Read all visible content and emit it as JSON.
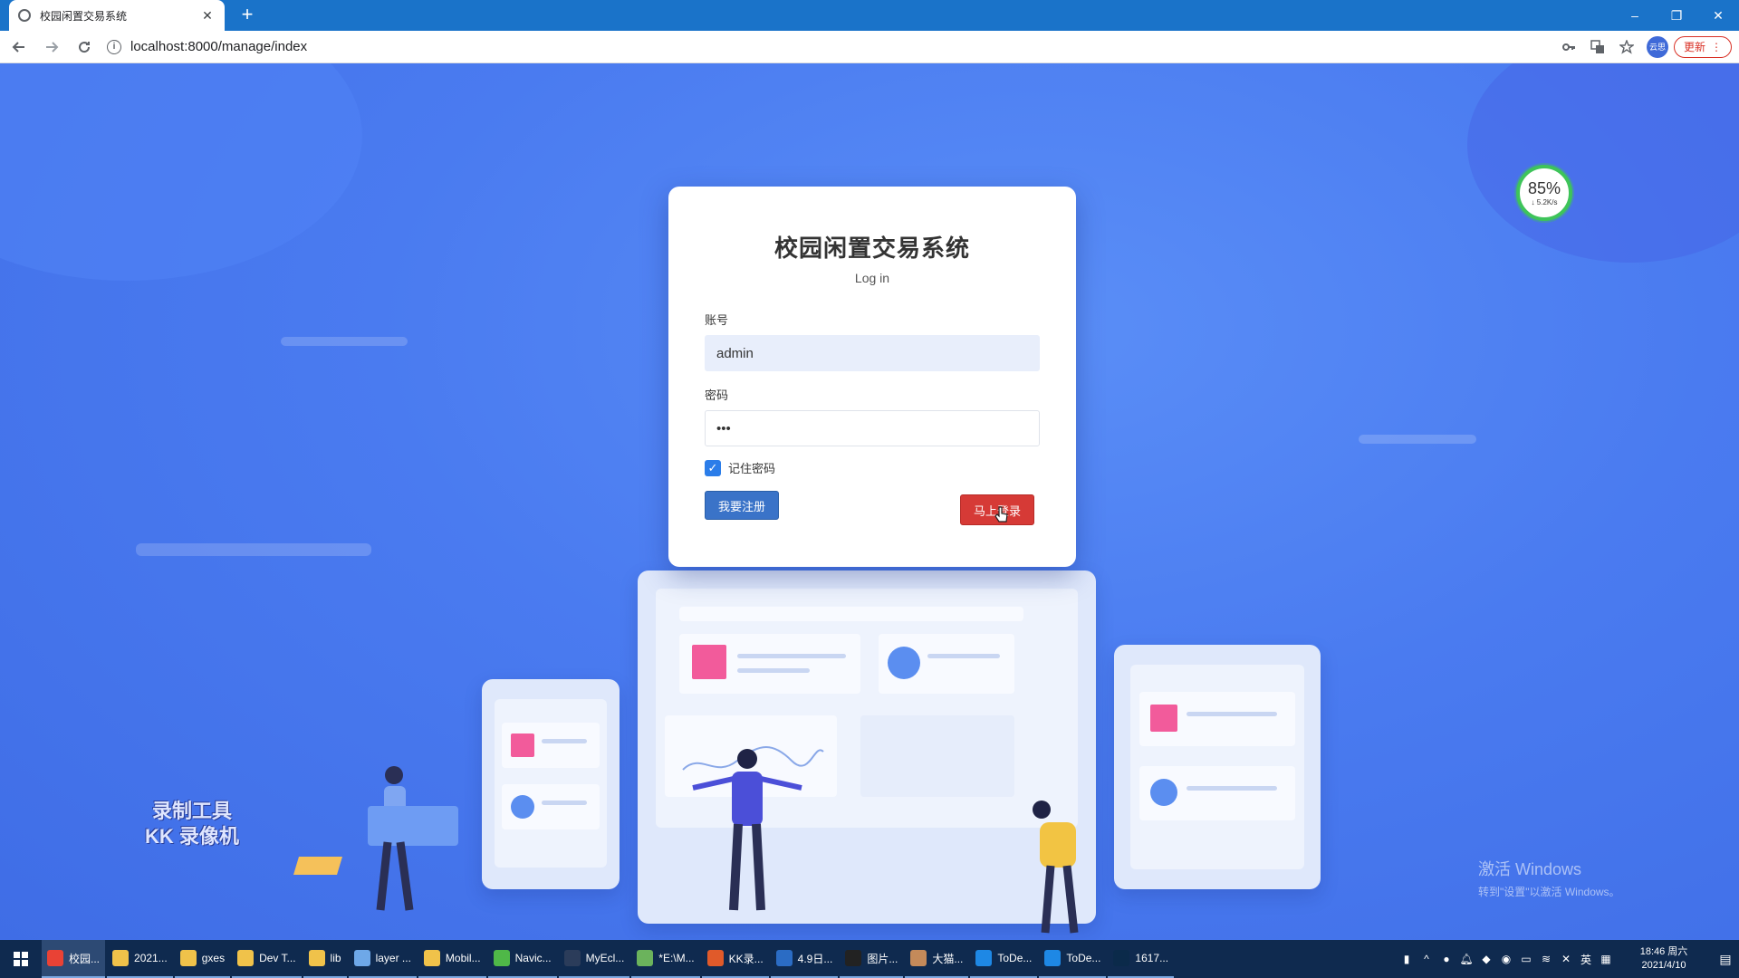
{
  "browser": {
    "tab_title": "校园闲置交易系统",
    "tab_close": "✕",
    "new_tab": "+",
    "url": "localhost:8000/manage/index",
    "profile_label": "云思",
    "update_label": "更新",
    "window_controls": {
      "minimize": "–",
      "restore": "❐",
      "close": "✕"
    }
  },
  "login": {
    "title": "校园闲置交易系统",
    "subtitle": "Log in",
    "account_label": "账号",
    "account_value": "admin",
    "password_label": "密码",
    "password_value": "•••",
    "remember_label": "记住密码",
    "remember_checked": true,
    "register_button": "我要注册",
    "login_button": "马上登录"
  },
  "speed_widget": {
    "percent": "85%",
    "rate": "↓ 5.2K/s"
  },
  "watermarks": {
    "kk_line1": "录制工具",
    "kk_line2": "KK 录像机",
    "windows_line1": "激活 Windows",
    "windows_line2": "转到\"设置\"以激活 Windows。"
  },
  "taskbar": {
    "items": [
      {
        "label": "校园...",
        "icon": "chrome-icon",
        "color": "#e94235",
        "active": true
      },
      {
        "label": "2021...",
        "icon": "folder-icon",
        "color": "#f0c24a"
      },
      {
        "label": "gxes",
        "icon": "folder-icon",
        "color": "#f0c24a"
      },
      {
        "label": "Dev T...",
        "icon": "folder-icon",
        "color": "#f0c24a"
      },
      {
        "label": "lib",
        "icon": "folder-icon",
        "color": "#f0c24a"
      },
      {
        "label": "layer ...",
        "icon": "cube-icon",
        "color": "#6ea8e8"
      },
      {
        "label": "Mobil...",
        "icon": "folder-icon",
        "color": "#f0c24a"
      },
      {
        "label": "Navic...",
        "icon": "navicat-icon",
        "color": "#4fb848"
      },
      {
        "label": "MyEcl...",
        "icon": "myeclipse-icon",
        "color": "#2b3c5a"
      },
      {
        "label": "*E:\\M...",
        "icon": "notepad-icon",
        "color": "#6bb35c"
      },
      {
        "label": "KK录...",
        "icon": "kk-icon",
        "color": "#e05a2a"
      },
      {
        "label": "4.9日...",
        "icon": "word-icon",
        "color": "#2b6cc4"
      },
      {
        "label": "图片...",
        "icon": "qq-icon",
        "color": "#222"
      },
      {
        "label": "大猫...",
        "icon": "avatar-icon",
        "color": "#c48a5a"
      },
      {
        "label": "ToDe...",
        "icon": "todesk-icon",
        "color": "#1e88e5"
      },
      {
        "label": "ToDe...",
        "icon": "todesk-icon",
        "color": "#1e88e5"
      },
      {
        "label": "1617...",
        "icon": "photoshop-icon",
        "color": "#0b2a4a"
      }
    ],
    "ime": "英",
    "time": "18:46 周六",
    "date": "2021/4/10"
  }
}
